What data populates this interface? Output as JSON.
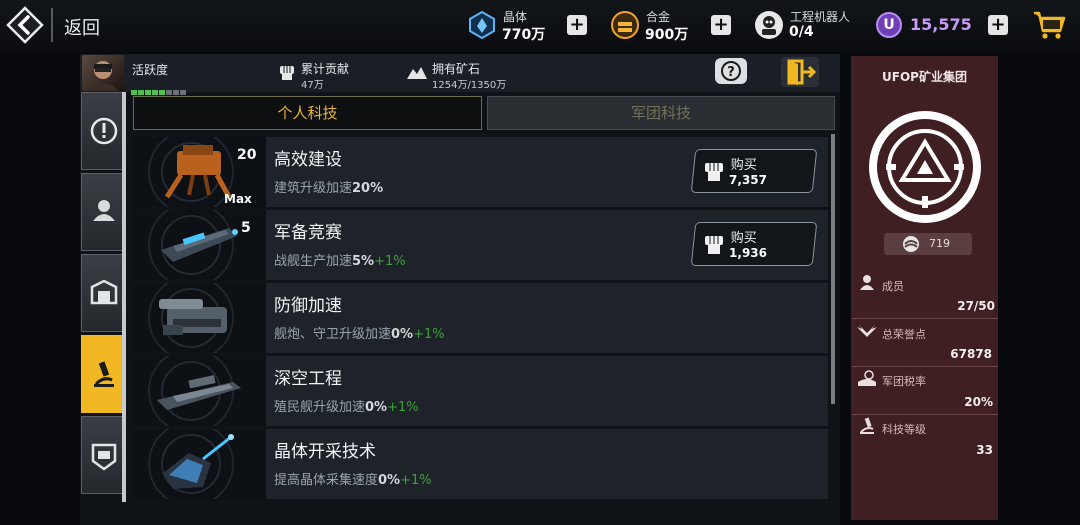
{
  "topbar": {
    "back_label": "返回",
    "resources": [
      {
        "label": "晶体",
        "value": "770万",
        "icon": "crystal-icon",
        "color": "#4aa9e8"
      },
      {
        "label": "合金",
        "value": "900万",
        "icon": "alloy-icon",
        "color": "#f0a526"
      },
      {
        "label": "工程机器人",
        "value": "0/4",
        "icon": "robot-icon"
      }
    ],
    "premium": {
      "symbol": "U",
      "value": "15,575",
      "color": "#c79cf5"
    },
    "plus": "+"
  },
  "info": {
    "activity_label": "活跃度",
    "contribution_label": "累计贡献",
    "contribution_value": "47万",
    "ore_label": "拥有矿石",
    "ore_value": "1254万/1350万"
  },
  "tabs": {
    "personal": "个人科技",
    "legion": "军团科技"
  },
  "side_tabs": [
    "alert-icon",
    "person-icon",
    "hangar-icon",
    "microscope-icon",
    "legion-icon"
  ],
  "tech_list": [
    {
      "title": "高效建设",
      "desc_prefix": "建筑升级加速",
      "desc_value": "20%",
      "desc_bonus": "",
      "level": "20",
      "max_label": "Max",
      "buy_label": "购买",
      "buy_value": "7,357"
    },
    {
      "title": "军备竞赛",
      "desc_prefix": "战舰生产加速",
      "desc_value": "5%",
      "desc_bonus": "+1%",
      "level": "5",
      "max_label": "",
      "buy_label": "购买",
      "buy_value": "1,936"
    },
    {
      "title": "防御加速",
      "desc_prefix": "舰炮、守卫升级加速",
      "desc_value": "0%",
      "desc_bonus": "+1%",
      "level": "",
      "max_label": "",
      "buy_label": "",
      "buy_value": ""
    },
    {
      "title": "深空工程",
      "desc_prefix": "殖民舰升级加速",
      "desc_value": "0%",
      "desc_bonus": "+1%",
      "level": "",
      "max_label": "",
      "buy_label": "",
      "buy_value": ""
    },
    {
      "title": "晶体开采技术",
      "desc_prefix": "提高晶体采集速度",
      "desc_value": "0%",
      "desc_bonus": "+1%",
      "level": "",
      "max_label": "",
      "buy_label": "",
      "buy_value": ""
    }
  ],
  "legion": {
    "name": "UFOP矿业集团",
    "score": "719",
    "stats": [
      {
        "label": "成员",
        "value": "27/50",
        "icon": "member-icon"
      },
      {
        "label": "总荣誉点",
        "value": "67878",
        "icon": "wings-icon"
      },
      {
        "label": "军团税率",
        "value": "20%",
        "icon": "tax-icon"
      },
      {
        "label": "科技等级",
        "value": "33",
        "icon": "microscope-icon"
      }
    ]
  }
}
